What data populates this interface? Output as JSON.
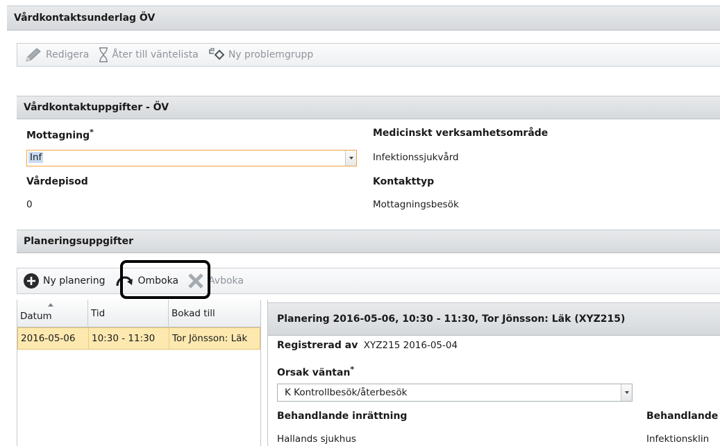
{
  "window": {
    "title": "Vårdkontaktsunderlag ÖV"
  },
  "toolbar": {
    "edit_label": "Redigera",
    "back_label": "Åter till väntelista",
    "newgroup_label": "Ny problemgrupp"
  },
  "contact_section": {
    "title": "Vårdkontaktuppgifter - ÖV",
    "mottagning_label": "Mottagning",
    "mottagning_value": "Inf",
    "medicinskt_label": "Medicinskt verksamhetsområde",
    "medicinskt_value": "Infektionssjukvård",
    "vardepisod_label": "Vårdepisod",
    "vardepisod_value": "0",
    "kontakttyp_label": "Kontakttyp",
    "kontakttyp_value": "Mottagningsbesök",
    "required_mark": "*"
  },
  "planning_section": {
    "title": "Planeringsuppgifter",
    "new_label": "Ny planering",
    "rebook_label": "Omboka",
    "cancel_label": "Avboka"
  },
  "grid": {
    "columns": [
      "Datum",
      "Tid",
      "Bokad till"
    ],
    "rows": [
      [
        "2016-05-06",
        "10:30 - 11:30",
        "Tor Jönsson: Läk"
      ]
    ]
  },
  "detail": {
    "header": "Planering 2016-05-06, 10:30 - 11:30, Tor Jönsson: Läk (XYZ215)",
    "registered_label": "Registrerad av",
    "registered_value": "XYZ215 2016-05-04",
    "reason_label": "Orsak väntan",
    "reason_value": "K Kontrollbesök/återbesök",
    "behandlande_label": "Behandlande inrättning",
    "behandlande_value": "Hallands sjukhus",
    "behandlande2_label": "Behandlande",
    "behandlande2_value": "Infektionsklin"
  },
  "colors": {
    "accent_selected": "#fde9b0",
    "focus_border": "#f0a340",
    "highlight_box": "#000000",
    "icon_dark": "#2a2a2a"
  }
}
